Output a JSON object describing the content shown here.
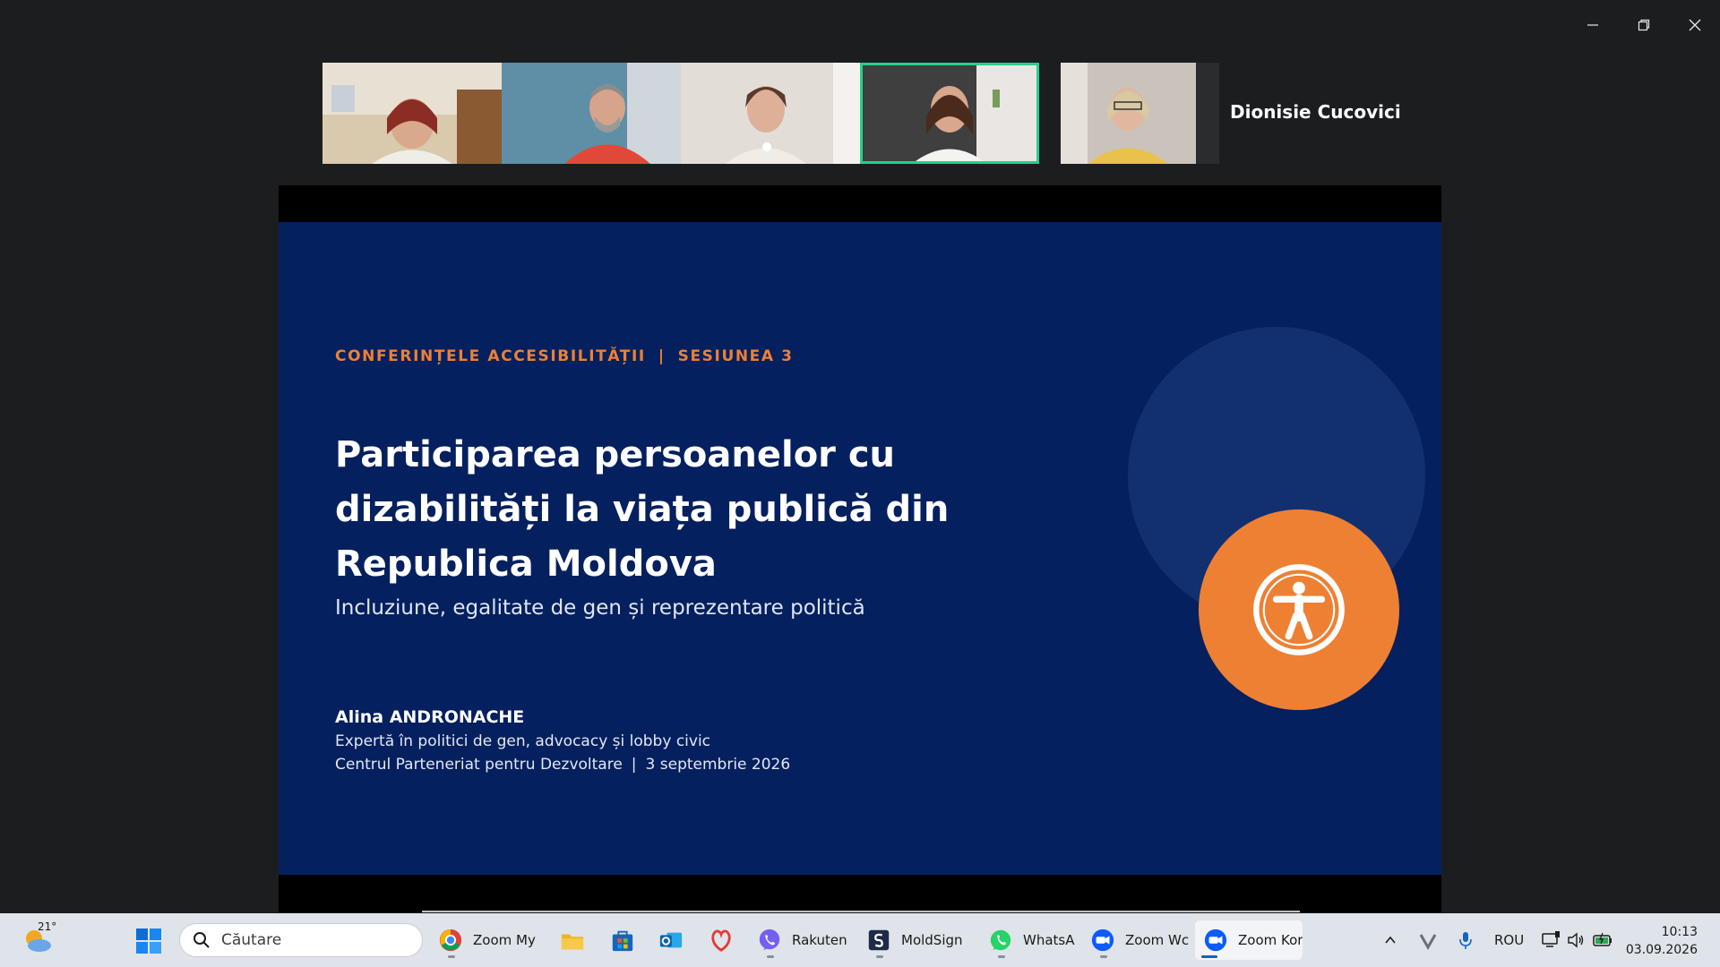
{
  "meeting": {
    "active_speaker_name": "Dionisie Cucovici"
  },
  "slide": {
    "kicker_left": "CONFERINȚELE ACCESIBILITĂȚII",
    "kicker_sep": "|",
    "kicker_right": "SESIUNEA 3",
    "title": "Participarea persoanelor cu dizabilități la viața publică din Republica Moldova",
    "subtitle": "Incluziune, egalitate de gen și reprezentare politică",
    "author": "Alina ANDRONACHE",
    "role": "Expertă în politici de gen, advocacy și lobby civic",
    "org": "Centrul Parteneriat pentru Dezvoltare",
    "org_sep": "|",
    "date": "3 septembrie 2026",
    "icon": "accessibility-icon",
    "colors": {
      "background": "#05205e",
      "accent": "#ee8033"
    }
  },
  "taskbar": {
    "weather_temp": "21°",
    "search_placeholder": "Căutare",
    "apps": [
      {
        "label": "Zoom My I",
        "icon": "chrome-icon"
      },
      {
        "label": "",
        "icon": "file-explorer-icon"
      },
      {
        "label": "",
        "icon": "store-icon"
      },
      {
        "label": "",
        "icon": "outlook-icon"
      },
      {
        "label": "",
        "icon": "app-icon"
      },
      {
        "label": "Rakuten",
        "icon": "viber-icon"
      },
      {
        "label": "MoldSign I",
        "icon": "moldsign-icon"
      },
      {
        "label": "WhatsA",
        "icon": "whatsapp-icon"
      },
      {
        "label": "Zoom Wc",
        "icon": "zoom-icon"
      },
      {
        "label": "Zoom Kor",
        "icon": "zoom-icon"
      }
    ],
    "language": "ROU",
    "time": "10:13",
    "date": "03.09.2026"
  }
}
